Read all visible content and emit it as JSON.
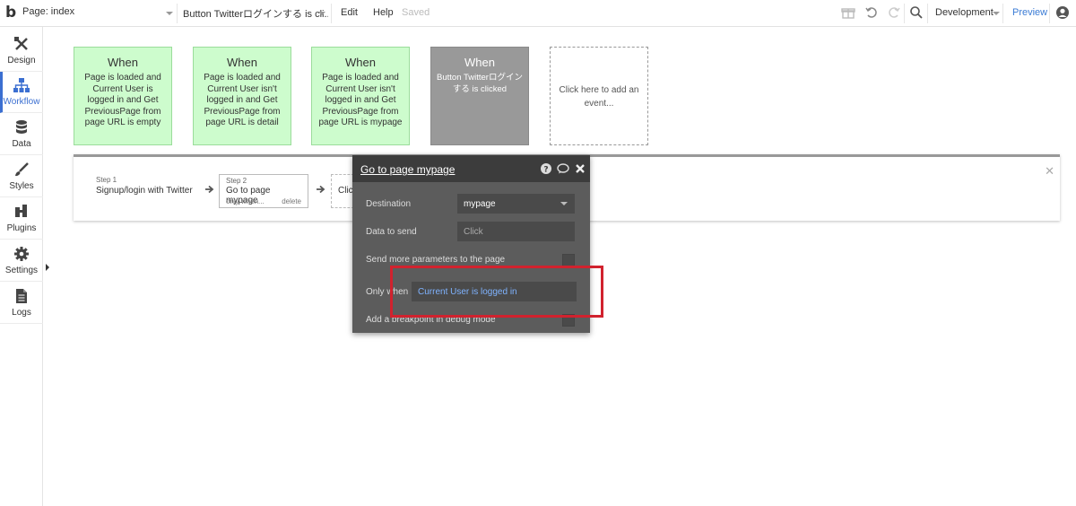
{
  "topbar": {
    "logo": "b",
    "page_select": "Page: index",
    "event_select": "Button Twitterログインする is cli...",
    "menu": {
      "edit": "Edit",
      "help": "Help",
      "saved": "Saved"
    },
    "environment": "Development",
    "preview": "Preview",
    "icons": [
      "gift-icon",
      "undo-icon",
      "redo-icon",
      "search-icon",
      "user-icon"
    ]
  },
  "sidebar": {
    "items": [
      {
        "label": "Design",
        "icon": "design-tools-icon"
      },
      {
        "label": "Workflow",
        "icon": "workflow-icon",
        "active": true
      },
      {
        "label": "Data",
        "icon": "database-icon"
      },
      {
        "label": "Styles",
        "icon": "brush-icon"
      },
      {
        "label": "Plugins",
        "icon": "plug-icon"
      },
      {
        "label": "Settings",
        "icon": "gear-icon"
      },
      {
        "label": "Logs",
        "icon": "document-icon"
      }
    ]
  },
  "events": [
    {
      "when": "When",
      "condition": "Page is loaded and Current User is logged in and Get PreviousPage from page URL is empty"
    },
    {
      "when": "When",
      "condition": "Page is loaded and Current User isn't logged in and Get PreviousPage from page URL is detail"
    },
    {
      "when": "When",
      "condition": "Page is loaded and Current User isn't logged in and Get PreviousPage from page URL is mypage"
    },
    {
      "when": "When",
      "condition": "Button Twitterログインする is clicked",
      "selected": true
    }
  ],
  "add_event": "Click here to add an event...",
  "steps": {
    "step1": {
      "num": "Step 1",
      "name": "Signup/login with Twitter"
    },
    "step2": {
      "num": "Step 2",
      "name": "Go to page mypage",
      "sub": "only when...",
      "delete": "delete"
    },
    "step3": {
      "name": "Click here to add an action..."
    }
  },
  "popup": {
    "title": "Go to page mypage",
    "destination_label": "Destination",
    "destination_value": "mypage",
    "data_to_send_label": "Data to send",
    "data_to_send_placeholder": "Click",
    "more_params_label": "Send more parameters to the page",
    "only_when_label": "Only when",
    "only_when_value": "Current User is logged in",
    "breakpoint_label": "Add a breakpoint in debug mode"
  },
  "colors": {
    "event_green": "#cdfccd",
    "event_selected": "#999999",
    "popup_bg": "#5c5c5c",
    "popup_head": "#3c3c3c",
    "highlight_red": "#d1222e",
    "accent_blue": "#3b6fd1"
  }
}
